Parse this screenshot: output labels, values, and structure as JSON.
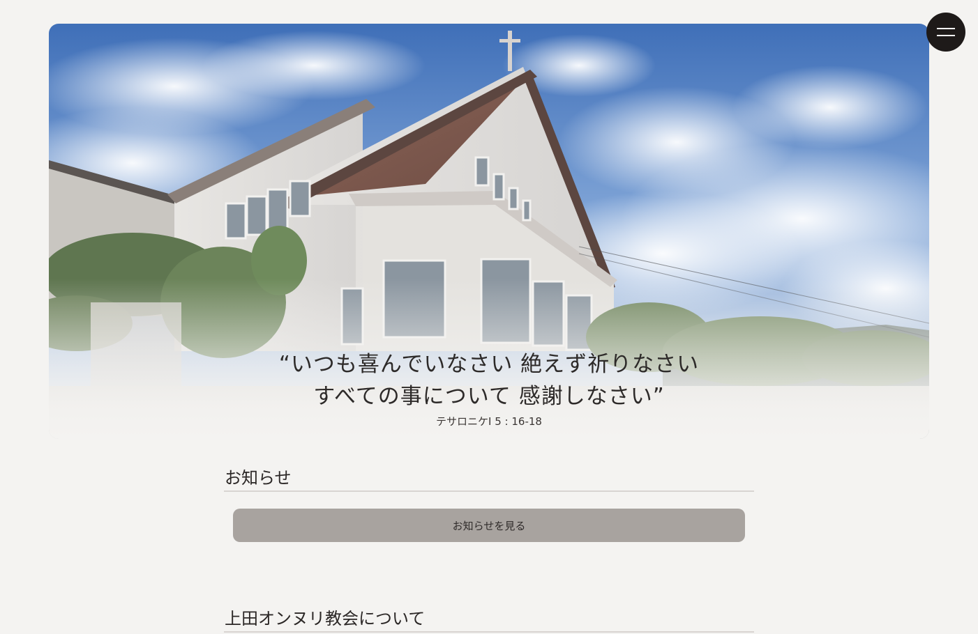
{
  "hero": {
    "image_alt": "church-building-photo",
    "verse_line1": "“いつも喜んでいなさい 絶えず祈りなさい",
    "verse_line2": "すべての事について 感謝しなさい”",
    "verse_reference": "テサロニケI 5 : 16-18"
  },
  "menu": {
    "icon": "hamburger-menu-icon"
  },
  "news": {
    "title": "お知らせ",
    "button_label": "お知らせを見る"
  },
  "about": {
    "title": "上田オンヌリ教会について"
  },
  "colors": {
    "background": "#f4f3f1",
    "button": "#a8a39f",
    "menu_button": "#1e1a19",
    "text": "#2b2726"
  }
}
